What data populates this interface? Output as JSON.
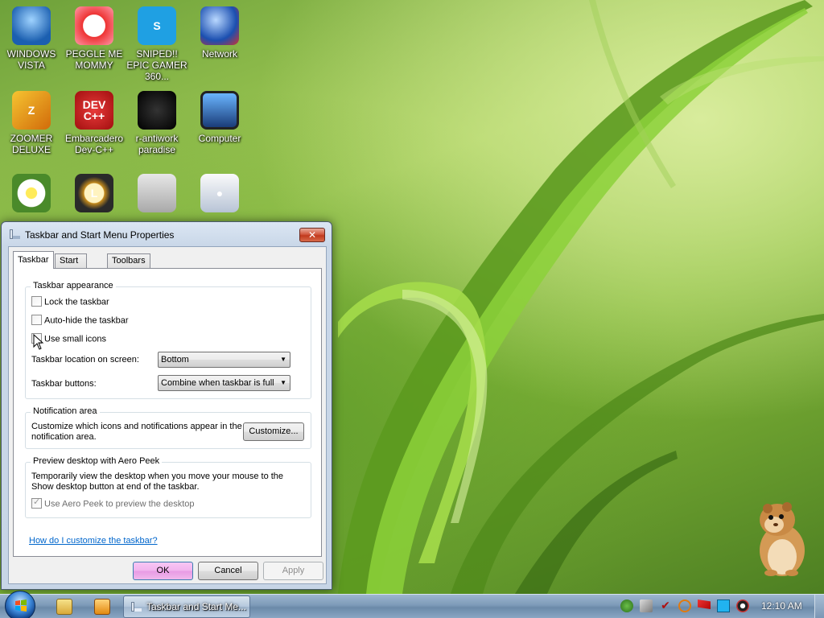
{
  "desktop": {
    "icons": [
      {
        "label": "WINDOWS VISTA",
        "icon": "vista-icon"
      },
      {
        "label": "PEGGLE ME MOMMY",
        "icon": "peggle-icon"
      },
      {
        "label": "SNIPED!! EPIC GAMER 360...",
        "icon": "skype-icon"
      },
      {
        "label": "Network",
        "icon": "network-icon"
      },
      {
        "label": "ZOOMER DELUXE",
        "icon": "zoomer-icon"
      },
      {
        "label": "Embarcadero Dev-C++",
        "icon": "devcpp-icon",
        "glyph": "DEV C++"
      },
      {
        "label": "r-antiwork paradise",
        "icon": "antiwork-icon"
      },
      {
        "label": "Computer",
        "icon": "computer-icon"
      },
      {
        "label": "",
        "icon": "flower-icon"
      },
      {
        "label": "",
        "icon": "clock-icon"
      },
      {
        "label": "",
        "icon": "folder-icon"
      },
      {
        "label": "",
        "icon": "installer-icon"
      }
    ]
  },
  "dialog": {
    "title": "Taskbar and Start Menu Properties",
    "close_label": "✕",
    "tabs": [
      {
        "label": "Taskbar",
        "active": true
      },
      {
        "label": "Start Menu",
        "active": false
      },
      {
        "label": "Toolbars",
        "active": false
      }
    ],
    "appearance": {
      "title": "Taskbar appearance",
      "lock_label": "Lock the taskbar",
      "lock_checked": false,
      "autohide_label": "Auto-hide the taskbar",
      "autohide_checked": false,
      "small_icons_label": "Use small icons",
      "small_icons_checked": false,
      "location_label": "Taskbar location on screen:",
      "location_value": "Bottom",
      "buttons_label": "Taskbar buttons:",
      "buttons_value": "Combine when taskbar is full"
    },
    "notification": {
      "title": "Notification area",
      "description": "Customize which icons and notifications appear in the notification area.",
      "customize_label": "Customize..."
    },
    "aero_peek": {
      "title": "Preview desktop with Aero Peek",
      "description": "Temporarily view the desktop when you move your mouse to the Show desktop button at end of the taskbar.",
      "use_label": "Use Aero Peek to preview the desktop",
      "use_checked": true
    },
    "help_link": "How do I customize the taskbar?",
    "ok_label": "OK",
    "cancel_label": "Cancel",
    "apply_label": "Apply"
  },
  "taskbar": {
    "start_icon": "windows-orb-icon",
    "quick_launch": [
      "explorer-icon",
      "media-player-icon"
    ],
    "tasks": [
      {
        "label": "Taskbar and Start Me...",
        "icon": "taskbar-properties-icon"
      }
    ],
    "tray_icons": [
      "tray-app-icon-1",
      "tray-app-icon-2",
      "tray-check-icon",
      "tray-search-icon",
      "tray-flag-icon",
      "tray-display-icon",
      "tray-volume-icon"
    ],
    "clock": "12:10 AM"
  },
  "colors": {
    "accent": "#3b86d8",
    "close_button": "#c13a1e",
    "ok_button": "#f1b3ee",
    "link": "#0066cc"
  }
}
